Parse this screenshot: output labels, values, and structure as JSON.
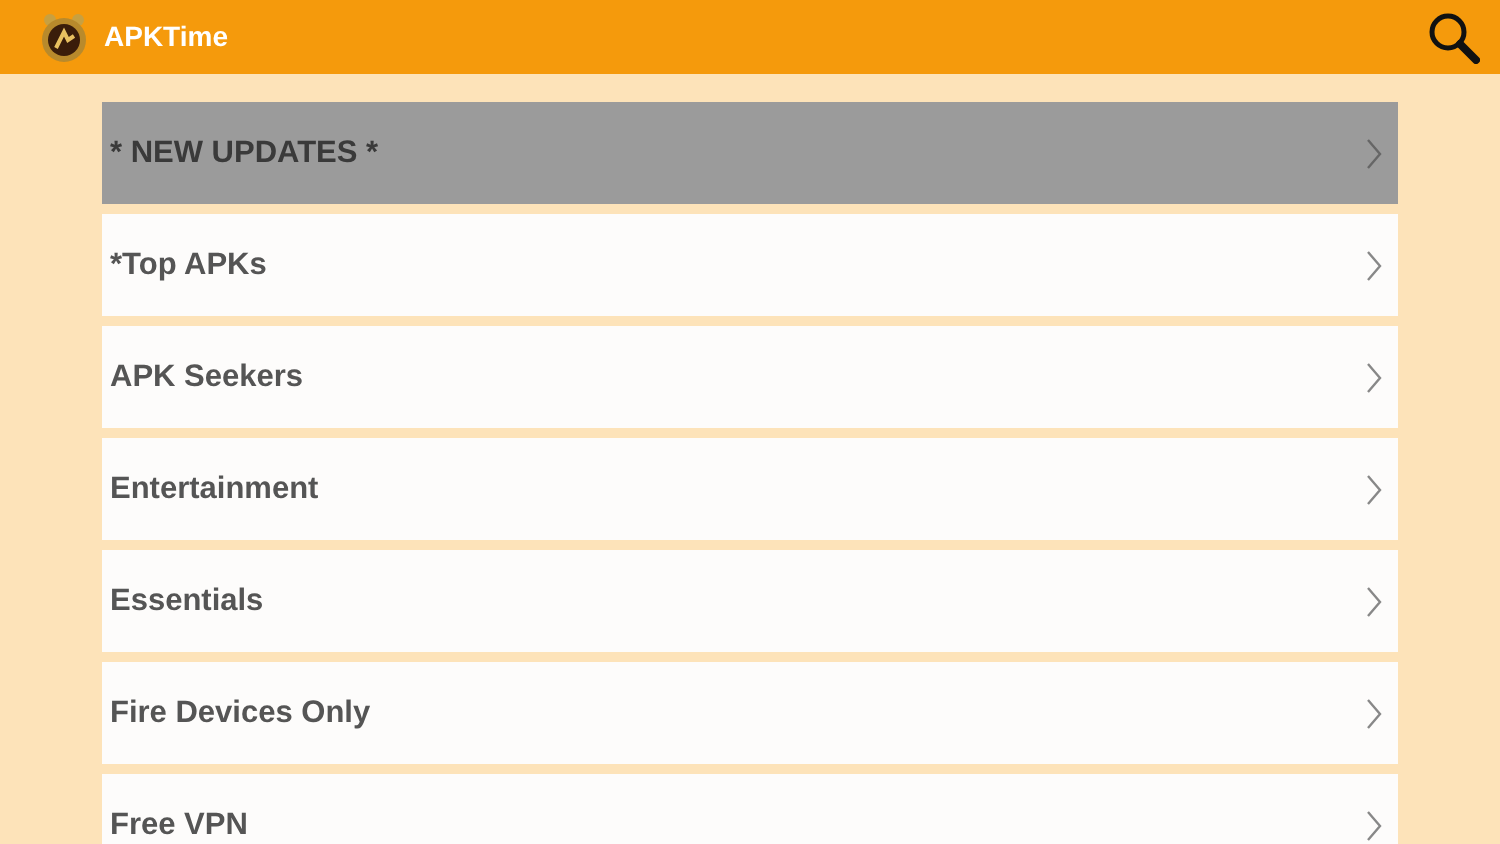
{
  "app_bar": {
    "title": "APKTime"
  },
  "categories": [
    {
      "label": "* NEW UPDATES *",
      "selected": true
    },
    {
      "label": "*Top APKs",
      "selected": false
    },
    {
      "label": "APK Seekers",
      "selected": false
    },
    {
      "label": "Entertainment",
      "selected": false
    },
    {
      "label": "Essentials",
      "selected": false
    },
    {
      "label": "Fire Devices Only",
      "selected": false
    },
    {
      "label": "Free VPN",
      "selected": false
    }
  ]
}
